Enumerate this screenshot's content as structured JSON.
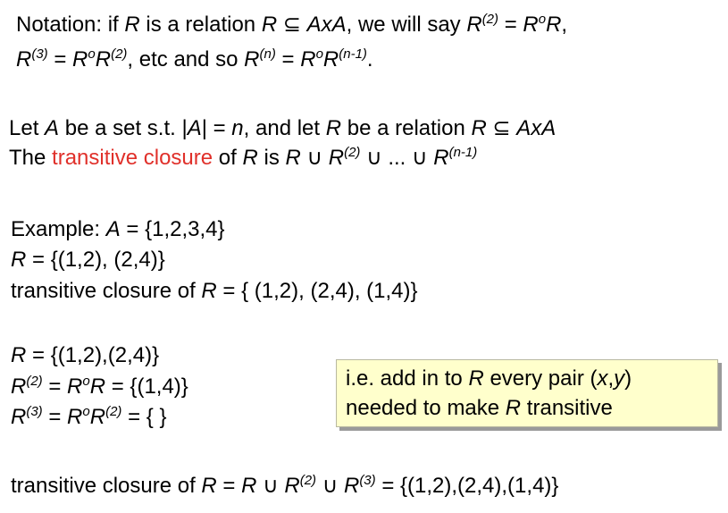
{
  "notation": {
    "l1_a": "Notation: if ",
    "l1_R": "R",
    "l1_b": " is a relation ",
    "l1_R2": "R",
    "l1_c": " ⊆ ",
    "l1_AxA": "AxA",
    "l1_d": ", we will say ",
    "l1_R3": "R",
    "l1_s2": "(2)",
    "l1_e": " = ",
    "l1_R4": "R",
    "l1_o": "o",
    "l1_R5": "R",
    "l1_f": ",",
    "l2_R": "R",
    "l2_s3": "(3)",
    "l2_a": " = ",
    "l2_R2": "R",
    "l2_o": "o",
    "l2_R3": "R",
    "l2_s2": "(2)",
    "l2_b": ", etc and so ",
    "l2_R4": "R",
    "l2_sn": "(n)",
    "l2_c": " = ",
    "l2_R5": "R",
    "l2_o2": "o",
    "l2_R6": "R",
    "l2_sn1": "(n-1)",
    "l2_d": "."
  },
  "definition": {
    "l1_a": "Let ",
    "l1_A": "A",
    "l1_b": " be a set s.t. |",
    "l1_A2": "A",
    "l1_c": "| = ",
    "l1_n": "n",
    "l1_d": ", and let ",
    "l1_R": "R",
    "l1_e": " be a relation ",
    "l1_R2": "R",
    "l1_f": " ⊆ ",
    "l1_AxA": "AxA",
    "l2_a": "The ",
    "l2_red": "transitive closure",
    "l2_b": " of ",
    "l2_R": "R",
    "l2_c": " is ",
    "l2_R2": "R",
    "l2_d": " ∪ ",
    "l2_R3": "R",
    "l2_s2": "(2)",
    "l2_e": " ∪ ... ∪ ",
    "l2_R4": "R",
    "l2_sn1": "(n-1)"
  },
  "example": {
    "l1_a": "Example: ",
    "l1_A": "A",
    "l1_b": " = {1,2,3,4}",
    "l2_R": "R",
    "l2_a": " = {(1,2), (2,4)}",
    "l3_a": "transitive closure of ",
    "l3_R": "R",
    "l3_b": " = { (1,2), (2,4), (1,4)}"
  },
  "computation": {
    "l1_R": "R",
    "l1_a": " = {(1,2),(2,4)}",
    "l2_R": "R",
    "l2_s2": "(2)",
    "l2_a": " = ",
    "l2_R2": "R",
    "l2_o": "o",
    "l2_R3": "R",
    "l2_b": " = {(1,4)}",
    "l3_R": "R",
    "l3_s3": "(3)",
    "l3_a": " = ",
    "l3_R2": "R",
    "l3_o": "o",
    "l3_R3": "R",
    "l3_s2": "(2)",
    "l3_b": " = { }"
  },
  "note": {
    "l1_a": "i.e. add in to ",
    "l1_R": "R",
    "l1_b": " every pair (",
    "l1_x": "x",
    "l1_comma": ",",
    "l1_y": "y",
    "l1_c": ")",
    "l2_a": "needed to make ",
    "l2_R": "R",
    "l2_b": " transitive"
  },
  "result": {
    "a": "transitive closure of ",
    "R": "R",
    "b": " = ",
    "R2": "R",
    "c": " ∪ ",
    "R3": "R",
    "s2": "(2)",
    "d": " ∪ ",
    "R4": "R",
    "s3": "(3)",
    "e": " = {(1,2),(2,4),(1,4)}"
  },
  "colors": {
    "highlight": "#e0302a",
    "note_background": "#ffffcc"
  }
}
